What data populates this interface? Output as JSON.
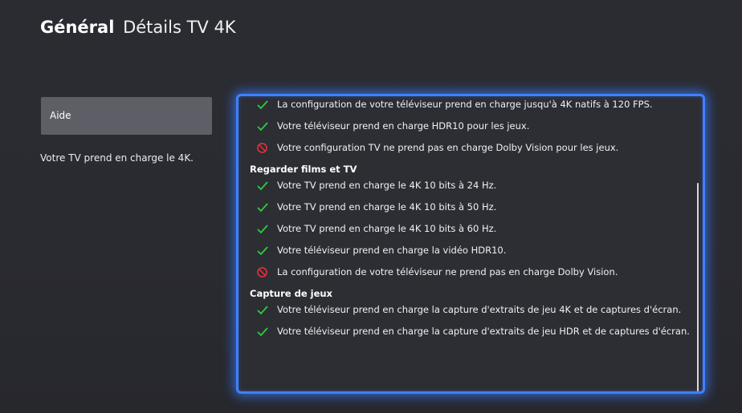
{
  "header": {
    "section": "Général",
    "page": "Détails TV 4K"
  },
  "sidebar": {
    "help_button": "Aide",
    "description": "Votre TV prend en charge le 4K."
  },
  "colors": {
    "accent": "#3f82ff",
    "ok": "#2ecc40",
    "not_supported": "#e0303a"
  },
  "details": {
    "game_items": [
      {
        "status": "ok",
        "text": "La configuration de votre téléviseur prend en charge jusqu'à 4K natifs à 120 FPS."
      },
      {
        "status": "ok",
        "text": "Votre téléviseur prend en charge HDR10 pour les jeux."
      },
      {
        "status": "no",
        "text": "Votre configuration TV ne prend pas en charge Dolby Vision pour les jeux."
      }
    ],
    "movies_title": "Regarder films et TV",
    "movies_items": [
      {
        "status": "ok",
        "text": "Votre TV prend en charge le 4K 10 bits à 24 Hz."
      },
      {
        "status": "ok",
        "text": "Votre TV prend en charge le 4K 10 bits à 50 Hz."
      },
      {
        "status": "ok",
        "text": "Votre TV prend en charge le 4K 10 bits à 60 Hz."
      },
      {
        "status": "ok",
        "text": "Votre téléviseur prend en charge la vidéo HDR10."
      },
      {
        "status": "no",
        "text": "La configuration de votre téléviseur ne prend pas en charge Dolby Vision."
      }
    ],
    "capture_title": "Capture de jeux",
    "capture_items": [
      {
        "status": "ok",
        "text": "Votre téléviseur prend en charge la capture d'extraits de jeu 4K et de captures d'écran."
      },
      {
        "status": "ok",
        "text": "Votre téléviseur prend en charge la capture d'extraits de jeu HDR et de captures d'écran."
      }
    ]
  }
}
